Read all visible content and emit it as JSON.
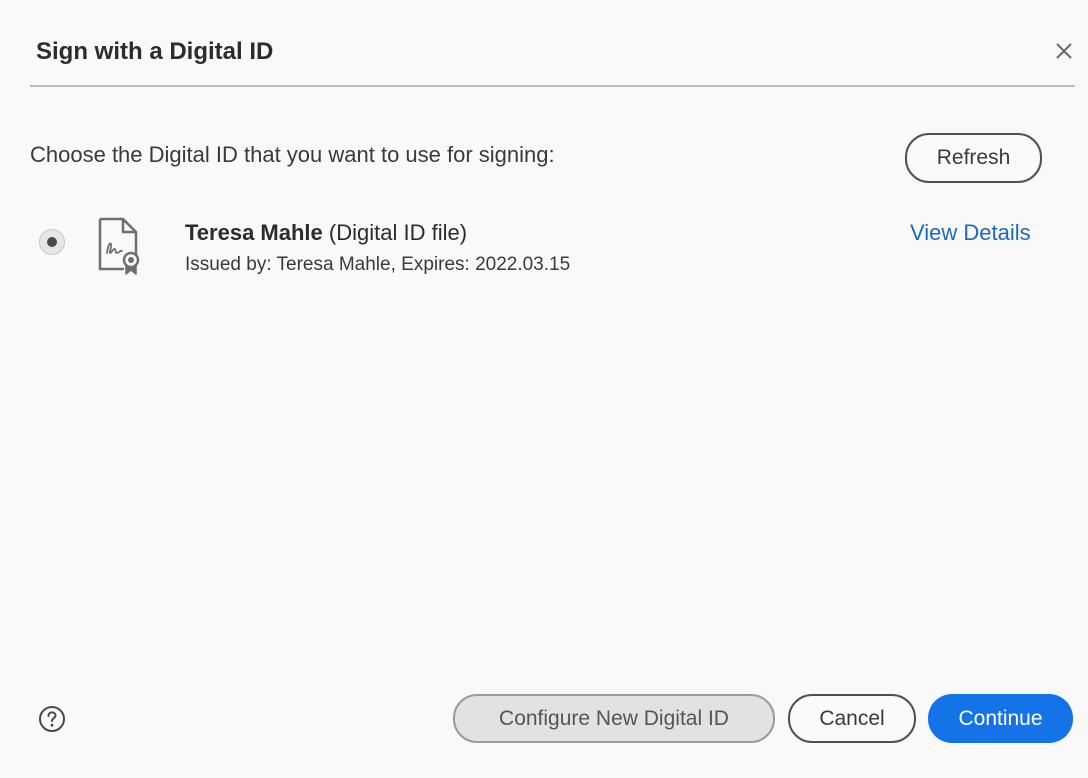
{
  "dialog": {
    "title": "Sign with a Digital ID",
    "prompt": "Choose the Digital ID that you want to use for signing:",
    "refresh_label": "Refresh"
  },
  "digital_ids": [
    {
      "name": "Teresa Mahle",
      "type": "(Digital ID file)",
      "issuer_line": "Issued by: Teresa Mahle, Expires: 2022.03.15",
      "selected": true,
      "view_details_label": "View Details"
    }
  ],
  "footer": {
    "configure_label": "Configure New Digital ID",
    "cancel_label": "Cancel",
    "continue_label": "Continue"
  },
  "icons": {
    "close": "close-icon",
    "certificate": "certificate-file-icon",
    "help": "help-icon"
  },
  "colors": {
    "accent": "#1473e6",
    "link": "#1b6ac0"
  }
}
